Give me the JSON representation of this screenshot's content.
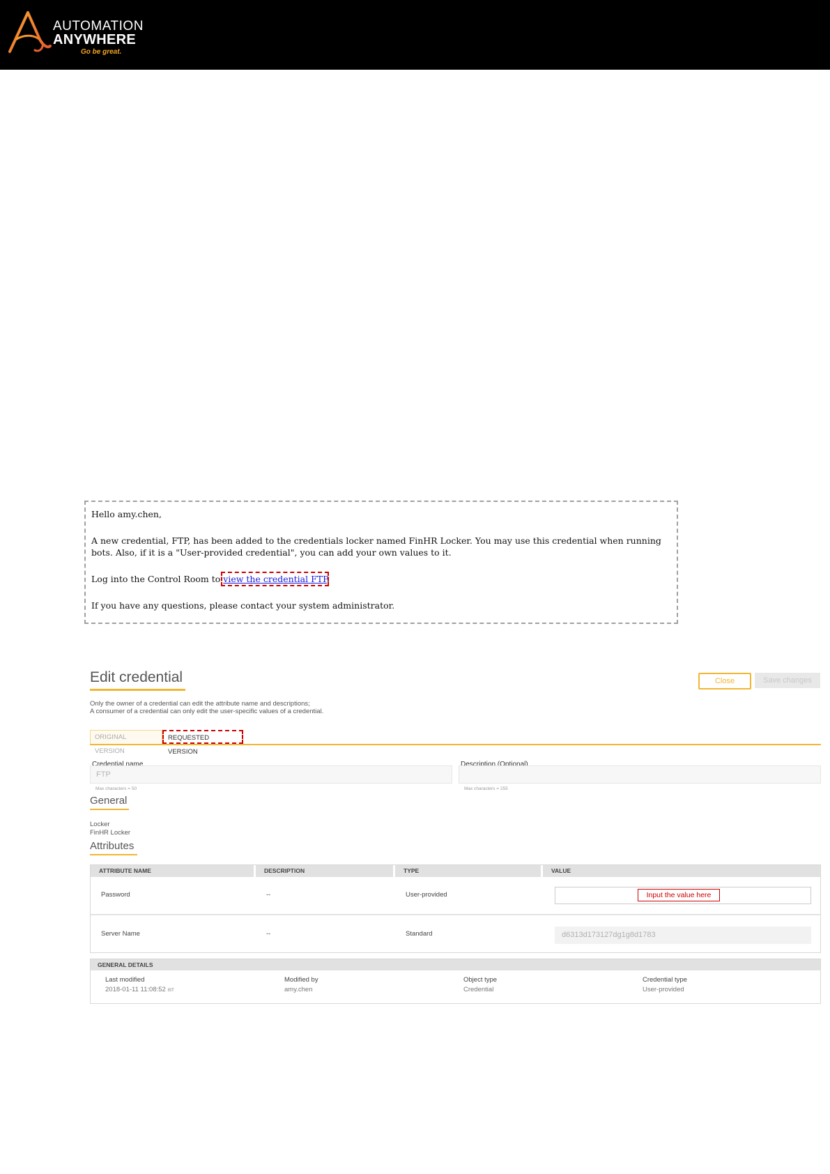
{
  "brand": {
    "line1": "AUTOMATION",
    "line2": "ANYWHERE",
    "tagline": "Go be great."
  },
  "email": {
    "greeting": "Hello amy.chen,",
    "body": "A new credential, FTP, has been added to the credentials locker named FinHR Locker. You may use this credential when running bots. Also, if it is a \"User-provided credential\", you can add your own values to it.",
    "login_prefix": "Log into the Control Room to ",
    "link_text": "view the credential FTP",
    "login_suffix": ".",
    "closing": "If you have any questions, please contact your system administrator."
  },
  "edit": {
    "title": "Edit credential",
    "close_label": "Close",
    "save_label": "Save changes",
    "note_line1": "Only the owner of a credential can edit the attribute name and descriptions;",
    "note_line2": "A consumer of a credential can only edit the user-specific values of a credential.",
    "tabs": [
      "ORIGINAL VERSION",
      "REQUESTED VERSION"
    ],
    "credential_name_label": "Credential name",
    "credential_name_value": "FTP",
    "credential_name_hint": "Max characters = 50",
    "description_label": "Description (Optional)",
    "description_value": "",
    "description_hint": "Max characters = 255",
    "general_heading": "General",
    "locker_label": "Locker",
    "locker_value": "FinHR Locker",
    "attributes_heading": "Attributes",
    "table_headers": [
      "ATTRIBUTE NAME",
      "DESCRIPTION",
      "TYPE",
      "VALUE"
    ],
    "rows": [
      {
        "name": "Password",
        "description": "--",
        "type": "User-provided",
        "value_hint": "Input the value here"
      },
      {
        "name": "Server Name",
        "description": "--",
        "type": "Standard",
        "value": "d6313d173127dg1g8d1783"
      }
    ],
    "details_heading": "GENERAL DETAILS",
    "details": [
      {
        "label": "Last modified",
        "value": "2018-01-11 11:08:52",
        "suffix": "IST"
      },
      {
        "label": "Modified by",
        "value": "amy.chen"
      },
      {
        "label": "Object type",
        "value": "Credential"
      },
      {
        "label": "Credential type",
        "value": "User-provided"
      }
    ]
  },
  "colors": {
    "accent": "#f2b632",
    "annotation": "#cc0000",
    "link": "#1a1adb"
  }
}
